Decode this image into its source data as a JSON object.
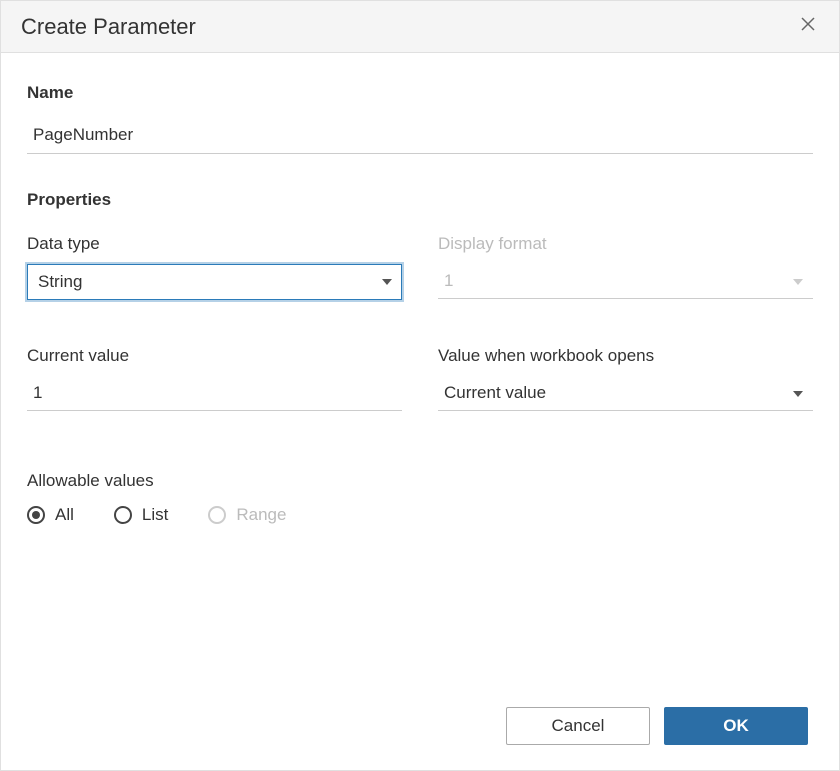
{
  "dialog": {
    "title": "Create Parameter"
  },
  "name": {
    "label": "Name",
    "value": "PageNumber"
  },
  "properties": {
    "label": "Properties",
    "dataType": {
      "label": "Data type",
      "value": "String"
    },
    "displayFormat": {
      "label": "Display format",
      "value": "1"
    },
    "currentValue": {
      "label": "Current value",
      "value": "1"
    },
    "valueWhenOpens": {
      "label": "Value when workbook opens",
      "value": "Current value"
    }
  },
  "allowable": {
    "label": "Allowable values",
    "options": {
      "all": "All",
      "list": "List",
      "range": "Range"
    },
    "selected": "all"
  },
  "buttons": {
    "cancel": "Cancel",
    "ok": "OK"
  }
}
